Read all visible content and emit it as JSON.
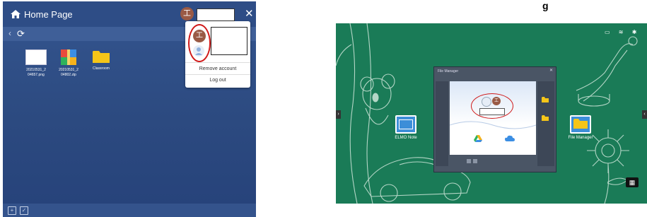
{
  "heading": {
    "text": "g"
  },
  "left": {
    "title": "Home Page",
    "avatar_initial": "工",
    "files": [
      {
        "name": "20210531_2\n04657.png"
      },
      {
        "name": "20210531_2\n04802.zip"
      },
      {
        "name": "Classroom"
      }
    ],
    "popup": {
      "avatar_initial": "工",
      "remove_account": "Remove account",
      "log_out": "Log out"
    }
  },
  "right": {
    "desktop_icons": [
      {
        "label": "ELMO Note"
      },
      {
        "label": "File Manager"
      }
    ],
    "file_manager": {
      "title": "File Manager",
      "avatar_initial": "工"
    },
    "colors": {
      "desktop": "#1a7b57",
      "left_panel": "#2c4a80",
      "highlight": "#d01a1a"
    }
  }
}
